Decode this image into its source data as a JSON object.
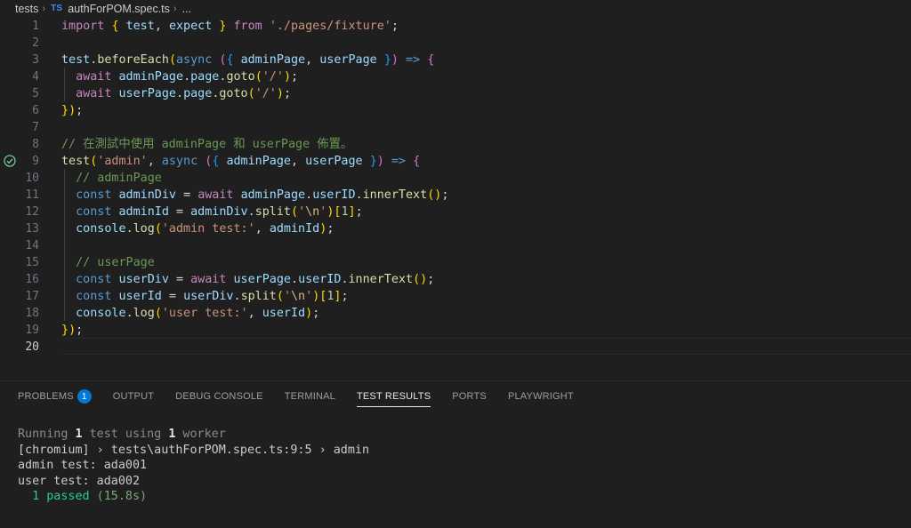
{
  "breadcrumb": {
    "folder": "tests",
    "file_icon": "TS",
    "file": "authForPOM.spec.ts",
    "ellipsis": "..."
  },
  "editor": {
    "active_line": "20",
    "test_status_icon": "check-circle-icon",
    "line_numbers": [
      "1",
      "2",
      "3",
      "4",
      "5",
      "6",
      "7",
      "8",
      "9",
      "10",
      "11",
      "12",
      "13",
      "14",
      "15",
      "16",
      "17",
      "18",
      "19",
      "20"
    ],
    "lines": [
      "import { test, expect } from './pages/fixture';",
      "",
      "test.beforeEach(async ({ adminPage, userPage }) => {",
      "  await adminPage.page.goto('/');",
      "  await userPage.page.goto('/');",
      "});",
      "",
      "// 在測試中使用 adminPage 和 userPage 佈置。",
      "test('admin', async ({ adminPage, userPage }) => {",
      "  // adminPage",
      "  const adminDiv = await adminPage.userID.innerText();",
      "  const adminId = adminDiv.split('\\n')[1];",
      "  console.log('admin test:', adminId);",
      "",
      "  // userPage",
      "  const userDiv = await userPage.userID.innerText();",
      "  const userId = userDiv.split('\\n')[1];",
      "  console.log('user test:', userId);",
      "});",
      ""
    ]
  },
  "panel": {
    "tabs": [
      {
        "label": "PROBLEMS",
        "badge": "1"
      },
      {
        "label": "OUTPUT"
      },
      {
        "label": "DEBUG CONSOLE"
      },
      {
        "label": "TERMINAL"
      },
      {
        "label": "TEST RESULTS",
        "active": true
      },
      {
        "label": "PORTS"
      },
      {
        "label": "PLAYWRIGHT"
      }
    ],
    "output": {
      "running_prefix": "Running ",
      "running_count": "1",
      "running_mid": " test using ",
      "worker_count": "1",
      "running_suffix": " worker",
      "chromium_line": "[chromium] › tests\\authForPOM.spec.ts:9:5 › admin",
      "admin_line": "admin test: ada001",
      "user_line": "user test: ada002",
      "passed_label": "  1 passed",
      "passed_time": " (15.8s)"
    }
  },
  "colors": {
    "background": "#1f1f1f",
    "keyword": "#c586c0",
    "string": "#ce9178",
    "comment": "#6a9955",
    "pass_green": "#23d18b",
    "badge_blue": "#0078d4"
  }
}
